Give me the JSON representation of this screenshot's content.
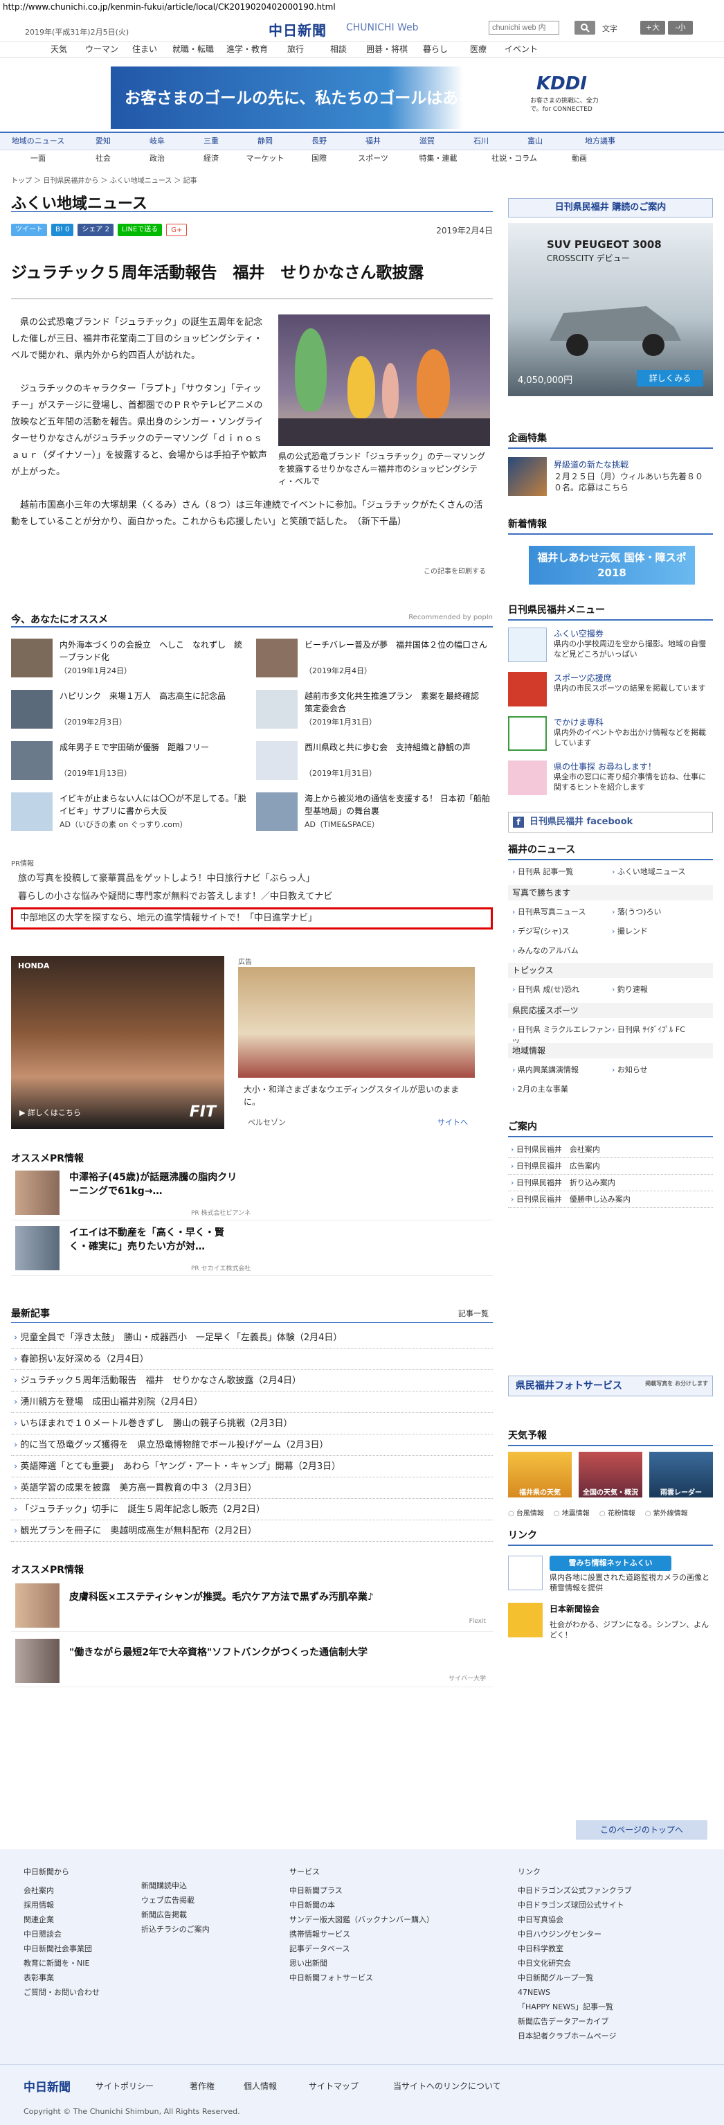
{
  "url": "http://www.chunichi.co.jp/kenmin-fukui/article/local/CK2019020402000190.html",
  "header": {
    "date": "2019年(平成31年)2月5日(火)",
    "logo": "中日新聞",
    "logo_sub": "CHUNICHI Web",
    "search_placeholder": "chunichi web 内",
    "font_label": "文字",
    "font_large": "+大",
    "font_small": "-小"
  },
  "top_nav": [
    "天気",
    "ウーマン",
    "住まい",
    "就職・転職",
    "進学・教育",
    "旅行",
    "相談",
    "囲碁・将棋",
    "暮らし",
    "医療",
    "イベント"
  ],
  "banner_ad": {
    "text": "お客さまのゴールの先に、私たちのゴールはある。",
    "brand": "KDDI",
    "sub": "お客さまの挑戦に、全力で。for CONNECTED"
  },
  "regional_nav": [
    "地域のニュース",
    "愛知",
    "岐阜",
    "三重",
    "静岡",
    "長野",
    "福井",
    "滋賀",
    "石川",
    "富山",
    "地方議事"
  ],
  "section_nav": [
    "一面",
    "社会",
    "政治",
    "経済",
    "マーケット",
    "国際",
    "スポーツ",
    "特集・連載",
    "社説・コラム",
    "動画"
  ],
  "breadcrumb": "トップ ＞ 日刊県民福井から ＞ ふくい地域ニュース ＞ 記事",
  "section_title": "ふくい地域ニュース",
  "share": {
    "tweet": "ツイート",
    "hatena": "B! 0",
    "facebook": "シェア 2",
    "line": "LINEで送る",
    "gplus": "G+"
  },
  "article": {
    "date": "2019年2月4日",
    "title": "ジュラチック５周年活動報告　福井　せりかなさん歌披露",
    "paragraphs": [
      "県の公式恐竜ブランド「ジュラチック」の誕生五周年を記念した催しが三日、福井市花堂南二丁目のショッピングシティ・ベルで開かれ、県内外から約四百人が訪れた。",
      "ジュラチックのキャラクター「ラプト」「サウタン」「ティッチー」がステージに登場し、首都圏でのＰＲやテレビアニメの放映など五年間の活動を報告。県出身のシンガー・ソングライターせりかなさんがジュラチックのテーマソング「ｄｉｎｏｓａｕｒ（ダイナソー）」を披露すると、会場からは手拍子や歓声が上がった。",
      "越前市国高小三年の大塚胡果（くるみ）さん（８つ）は三年連続でイベントに参加。「ジュラチックがたくさんの活動をしていることが分かり、面白かった。これからも応援したい」と笑顔で話した。　（新下千晶）"
    ],
    "caption": "県の公式恐竜ブランド「ジュラチック」のテーマソングを披露するせりかなさん＝福井市のショッピングシティ・ベルで",
    "print_label": "この記事を印刷する"
  },
  "recommend": {
    "title": "今、あなたにオススメ",
    "powered": "Recommended by popIn",
    "items": [
      {
        "title": "内外海本づくりの会設立　へしこ　なれずし　統一ブランド化",
        "date": "（2019年1月24日）",
        "color": "#7b6a5a"
      },
      {
        "title": "ビーチバレー普及が夢　福井国体２位の幅口さん",
        "date": "（2019年2月4日）",
        "color": "#8a7060"
      },
      {
        "title": "ハピリンク　来場１万人　高志高生に記念品",
        "date": "（2019年2月3日）",
        "color": "#5a6a7a"
      },
      {
        "title": "越前市多文化共生推進プラン　素案を最終確認　策定委会合",
        "date": "（2019年1月31日）",
        "color": "#d8e0e8"
      },
      {
        "title": "成年男子Ｅで宇田硝が優勝　距離フリー",
        "date": "（2019年1月13日）",
        "color": "#6a7a8a"
      },
      {
        "title": "西川県政と共に歩む会　支持組織と静観の声",
        "date": "（2019年1月31日）",
        "color": "#dde4ee"
      },
      {
        "title": "イビキが止まらない人には〇〇が不足してる。「脱イビキ」サプリに書から大反",
        "date": "AD（いびきの素 on ぐっすり.com）",
        "color": "#c0d4e8"
      },
      {
        "title": "海上から被災地の通信を支援する！ 日本初「船舶型基地局」の舞台裏",
        "date": "AD（TIME&SPACE）",
        "color": "#8aa0b8"
      }
    ]
  },
  "pr": {
    "label": "PR情報",
    "links": [
      "旅の写真を投稿して豪華賞品をゲットしよう！中日旅行ナビ「ぶらっ人」",
      "暮らしの小さな悩みや疑問に専門家が無料でお答えします！／中日教えてナビ"
    ],
    "highlight": "中部地区の大学を探すなら、地元の進学情報サイトで！「中日進学ナビ」"
  },
  "ads": {
    "honda_brand": "HONDA",
    "honda_more": "▶ 詳しくはこちら",
    "honda_model": "FIT",
    "wedding_label": "広告",
    "wedding_text": "大小・和洋さまざまなウエディングスタイルが思いのままに。",
    "wedding_sponsor": "ベルセゾン",
    "wedding_site": "サイトへ"
  },
  "osusume_pr": {
    "title": "オススメPR情報",
    "items": [
      {
        "title": "中澤裕子(45歳)が話題沸騰の脂肉クリーニングで61kg→…",
        "src": "PR 株式会社ビアンネ"
      },
      {
        "title": "イエイは不動産を「高く・早く・賢く・確実に」売りたい方が対…",
        "src": "PR セカイエ株式会社"
      }
    ]
  },
  "latest": {
    "title": "最新記事",
    "more": "記事一覧",
    "items": [
      "児童全員で「浮き太鼓」　勝山・成器西小　一足早く「左義長」体験（2月4日）",
      "春節拐い友好深める（2月4日）",
      "ジュラチック５周年活動報告　福井　せりかなさん歌披露（2月4日）",
      "湧川親方を登場　成田山福井別院（2月4日）",
      "いちほまれで１０メートル巻きずし　勝山の親子ら挑戦（2月3日）",
      "的に当て恐竜グッズ獲得を　県立恐竜博物館でボール投げゲーム（2月3日）",
      "英語陣選「とても重要」　あわら「ヤング・アート・キャンプ」開幕（2月3日）",
      "英語学習の成果を披露　美方高一貫教育の中３（2月3日）",
      "「ジュラチック」切手に　誕生５周年記念し販売（2月2日）",
      "観光プランを冊子に　奥越明成高生が無料配布（2月2日）"
    ]
  },
  "osusume_pr2": {
    "title": "オススメPR情報",
    "items": [
      {
        "title": "皮膚科医×エステティシャンが推奨。毛穴ケア方法で黒ずみ汚肌卒業♪",
        "src": "Flexit"
      },
      {
        "title": "\"働きながら最短2年で大卒資格\"ソフトバンクがつくった通信制大学",
        "src": "サイバー大学"
      }
    ]
  },
  "sidebar": {
    "subscribe": "日刊県民福井 購読のご案内",
    "suv_ad": {
      "title": "SUV PEUGEOT 3008",
      "sub": "CROSSCITY デビュー",
      "price": "4,050,000円",
      "btn": "詳しくみる"
    },
    "feature_title": "企画特集",
    "feature": {
      "title": "昇級道の新たな挑戦",
      "desc": "２月２５日（月）ウィルあいち先着８００名。応募はこちら"
    },
    "new_title": "新着情報",
    "new_banner": "福井しあわせ元気 国体・障スポ 2018",
    "menu_title": "日刊県民福井メニュー",
    "menu": [
      {
        "title": "ふくい空撮券",
        "desc": "県内の小学校周辺を空から撮影。地域の自慢など見どころがいっぱい"
      },
      {
        "title": "スポーツ応援席",
        "desc": "県内の市民スポーツの結果を掲載しています"
      },
      {
        "title": "でかけま専科",
        "desc": "県内外のイベントやお出かけ情報などを掲載しています"
      },
      {
        "title": "県の仕事探 お尋ねします！",
        "desc": "県全市の窓口に寄り紹介事情を訪ね、仕事に関するヒントを紹介します"
      }
    ],
    "facebook": "日刊県民福井 facebook",
    "news_title": "福井のニュース",
    "news_grid": [
      "日刊県 記事一覧",
      "ふくい地域ニュース"
    ],
    "photo_sub": "写真で勝ちます",
    "photo_grid": [
      "日刊県写真ニュース",
      "落(うつ)ろい",
      "デジ写(シャ)ス",
      "撮レンド",
      "みんなのアルバム"
    ],
    "topics_sub": "トピックス",
    "topics_grid": [
      "日刊県 成(せ)恐れ",
      "釣り速報"
    ],
    "sports_sub": "県民応援スポーツ",
    "sports_grid": [
      "日刊県 ミラクルエレファンツ",
      "日刊県 ｻｲﾀﾞｲﾌﾟﾙ FC"
    ],
    "local_sub": "地域情報",
    "local_grid": [
      "県内興業講演情報",
      "お知らせ",
      "2月の主な事業"
    ],
    "annai_title": "ご案内",
    "annai": [
      "日刊県民福井　会社案内",
      "日刊県民福井　広告案内",
      "日刊県民福井　折り込み案内",
      "日刊県民福井　優勝申し込み案内"
    ],
    "photo_service": "県民福井フォトサービス",
    "photo_service_sub": "掲載写真を お分けします",
    "weather_title": "天気予報",
    "weather_boxes": [
      "福井県の天気",
      "全国の天気・概況",
      "雨雲レーダー"
    ],
    "weather_links": [
      "台風情報",
      "地震情報",
      "花粉情報",
      "紫外線情報"
    ],
    "link_title": "リンク",
    "links": [
      {
        "btn": "雪みち情報ネットふくい",
        "desc": "県内各地に設置された道路監視カメラの画像と積雪情報を提供"
      },
      {
        "title": "日本新聞協会",
        "desc": "社会がわかる、ジブンになる。シンブン、よんどく！"
      }
    ]
  },
  "totop": "このページのトップへ",
  "footer": {
    "col1_title": "中日新聞から",
    "col1a": [
      "会社案内",
      "採用情報",
      "関連企業",
      "中日懇談会",
      "中日新聞社会事業団",
      "教育に新聞を・NIE",
      "表彰事業",
      "ご質問・お問い合わせ"
    ],
    "col1b": [
      "新聞購読申込",
      "ウェブ広告掲載",
      "新聞広告掲載",
      "折込チラシのご案内"
    ],
    "col2_title": "サービス",
    "col2": [
      "中日新聞プラス",
      "中日新聞の本",
      "サンデー版大図鑑（バックナンバー購入）",
      "携帯情報サービス",
      "記事データベース",
      "思い出新聞",
      "中日新聞フォトサービス"
    ],
    "col3_title": "リンク",
    "col3": [
      "中日ドラゴンズ公式ファンクラブ",
      "中日ドラゴンズ球団公式サイト",
      "中日写真協会",
      "中日ハウジングセンター",
      "中日科学教室",
      "中日文化研究会",
      "中日新聞グループ一覧",
      "47NEWS",
      "「HAPPY NEWS」記事一覧",
      "新聞広告データアーカイブ",
      "日本記者クラブホームページ"
    ],
    "bar_logo": "中日新聞",
    "bar_links": [
      "サイトポリシー",
      "著作権",
      "個人情報",
      "サイトマップ",
      "当サイトへのリンクについて"
    ],
    "copyright": "Copyright © The Chunichi Shimbun, All Rights Reserved."
  },
  "colors": {
    "accent": "#3b6fc0",
    "brand": "#1a3f8f",
    "highlight": "#e00000"
  }
}
